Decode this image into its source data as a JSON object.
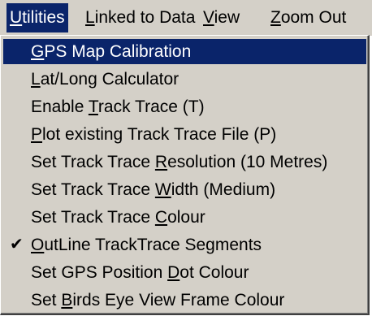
{
  "menubar": {
    "items": [
      {
        "pre": "",
        "u": "U",
        "post": "tilities"
      },
      {
        "pre": "",
        "u": "L",
        "post": "inked to Data"
      },
      {
        "pre": "",
        "u": "V",
        "post": "iew"
      },
      {
        "pre": "",
        "u": "Z",
        "post": "oom Out"
      }
    ]
  },
  "menu": {
    "items": [
      {
        "pre": "",
        "u": "G",
        "post": "PS Map Calibration",
        "checked": false
      },
      {
        "pre": "",
        "u": "L",
        "post": "at/Long Calculator",
        "checked": false
      },
      {
        "pre": "Enable ",
        "u": "T",
        "post": "rack Trace (T)",
        "checked": false
      },
      {
        "pre": "",
        "u": "P",
        "post": "lot existing Track Trace File (P)",
        "checked": false
      },
      {
        "pre": "Set Track Trace ",
        "u": "R",
        "post": "esolution  (10 Metres)",
        "checked": false
      },
      {
        "pre": "Set Track Trace ",
        "u": "W",
        "post": "idth   (Medium)",
        "checked": false
      },
      {
        "pre": "Set Track Trace  ",
        "u": "C",
        "post": "olour",
        "checked": false
      },
      {
        "pre": "",
        "u": "O",
        "post": "utLine TrackTrace Segments",
        "checked": true,
        "check_icon": "checkmark-icon"
      },
      {
        "pre": "Set GPS Position ",
        "u": "D",
        "post": "ot Colour",
        "checked": false
      },
      {
        "pre": "Set ",
        "u": "B",
        "post": "irds Eye View Frame Colour",
        "checked": false
      }
    ]
  },
  "check_glyph": "✔",
  "colors": {
    "highlight": "#0a246a",
    "menu_bg": "#d4d0c8"
  }
}
